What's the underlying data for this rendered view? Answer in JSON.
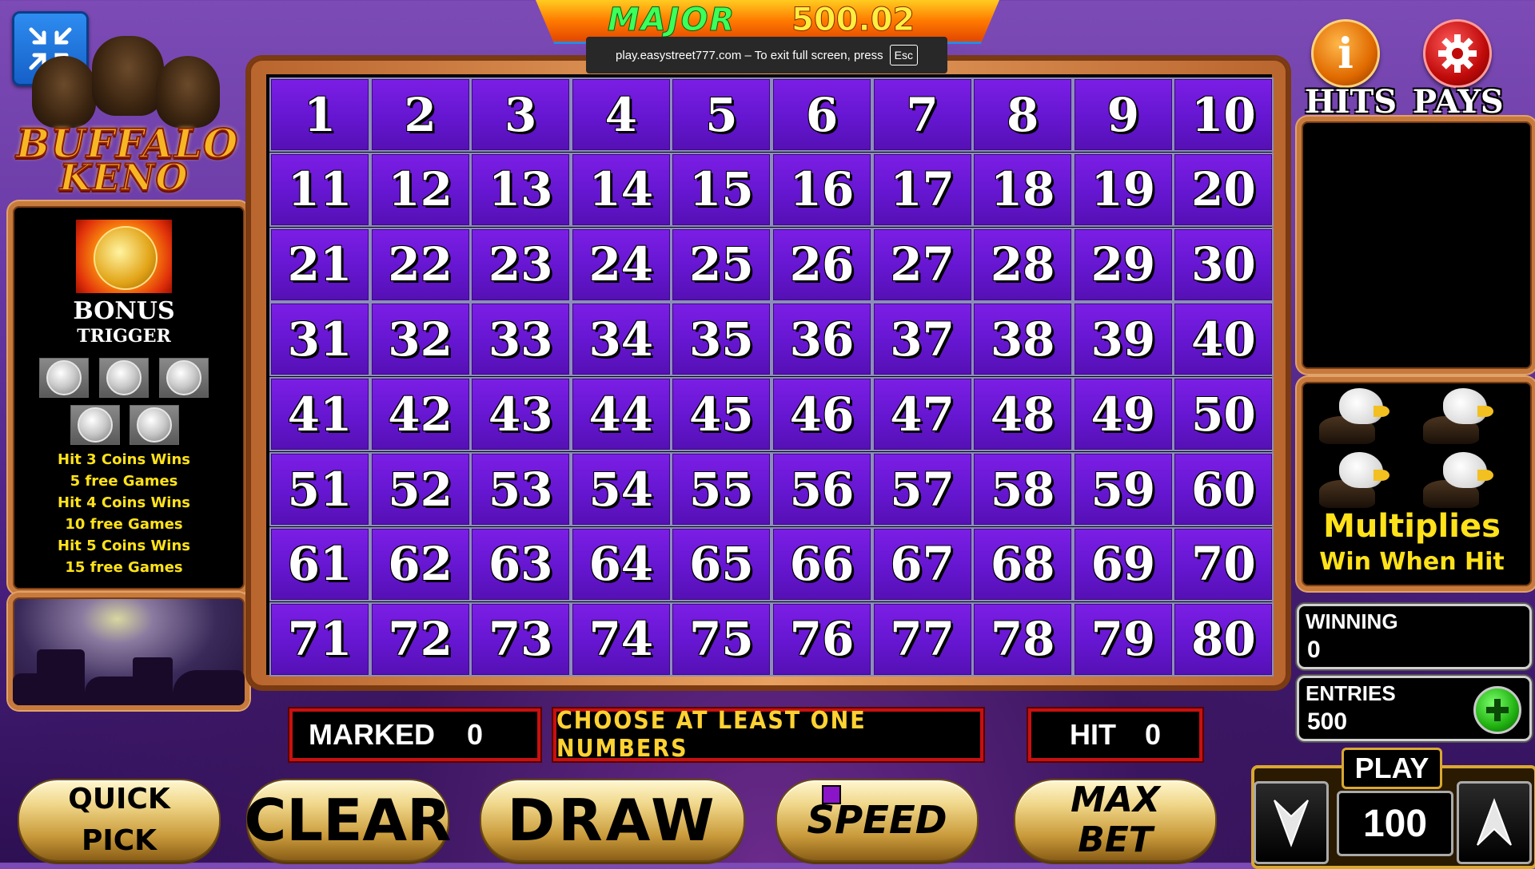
{
  "jackpot": {
    "label": "MAJOR",
    "amount": "500.02"
  },
  "fullscreen_notice": {
    "text": "play.easystreet777.com – To exit full screen, press",
    "key": "Esc"
  },
  "logo": {
    "line1": "BUFFALO",
    "line2": "KENO"
  },
  "bonus": {
    "title": "BONUS",
    "subtitle": "TRIGGER",
    "lines": [
      "Hit 3 Coins Wins",
      "5 free Games",
      "Hit 4 Coins Wins",
      "10 free Games",
      "Hit 5 Coins Wins",
      "15 free Games"
    ]
  },
  "board": {
    "numbers": [
      1,
      2,
      3,
      4,
      5,
      6,
      7,
      8,
      9,
      10,
      11,
      12,
      13,
      14,
      15,
      16,
      17,
      18,
      19,
      20,
      21,
      22,
      23,
      24,
      25,
      26,
      27,
      28,
      29,
      30,
      31,
      32,
      33,
      34,
      35,
      36,
      37,
      38,
      39,
      40,
      41,
      42,
      43,
      44,
      45,
      46,
      47,
      48,
      49,
      50,
      51,
      52,
      53,
      54,
      55,
      56,
      57,
      58,
      59,
      60,
      61,
      62,
      63,
      64,
      65,
      66,
      67,
      68,
      69,
      70,
      71,
      72,
      73,
      74,
      75,
      76,
      77,
      78,
      79,
      80
    ]
  },
  "paytable": {
    "hits_label": "HITS",
    "pays_label": "PAYS"
  },
  "multiplier": {
    "line1": "Multiplies",
    "line2": "Win When Hit"
  },
  "winning": {
    "label": "WINNING",
    "value": "0"
  },
  "entries": {
    "label": "ENTRIES",
    "value": "500"
  },
  "status": {
    "marked_label": "MARKED",
    "marked_value": "0",
    "message": "CHOOSE AT LEAST ONE NUMBERS",
    "hit_label": "HIT",
    "hit_value": "0"
  },
  "buttons": {
    "quick_pick_line1": "QUICK",
    "quick_pick_line2": "PICK",
    "clear": "CLEAR",
    "draw": "DRAW",
    "speed": "SPEED",
    "max_bet_line1": "MAX",
    "max_bet_line2": "BET"
  },
  "play": {
    "label": "PLAY",
    "value": "100"
  },
  "info_button": {
    "glyph": "i"
  },
  "colors": {
    "cell": "#6516d0",
    "accent_yellow": "#ffe21a",
    "status_border": "#c81010",
    "frame": "#c77a3c"
  }
}
